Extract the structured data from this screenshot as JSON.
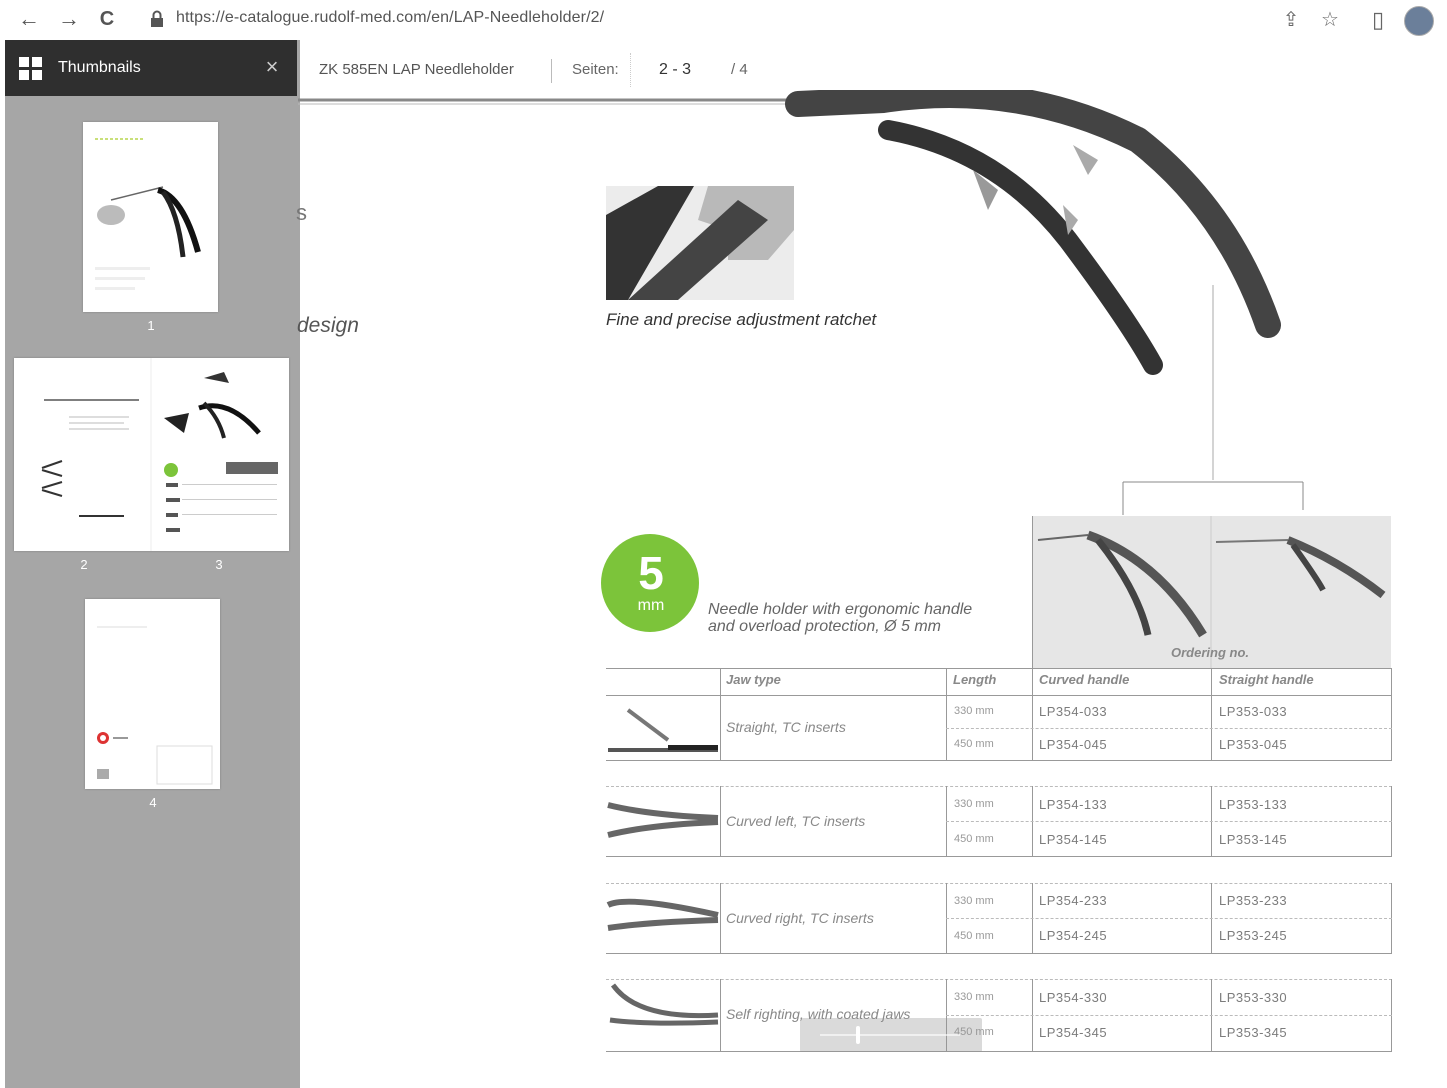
{
  "browser": {
    "url": "https://e-catalogue.rudolf-med.com/en/LAP-Needleholder/2/",
    "back_icon": "←",
    "forward_icon": "→",
    "reload_icon": "C",
    "share_icon": "⇪",
    "star_icon": "☆",
    "sidepanel_icon": "▯"
  },
  "sidebar": {
    "title": "Thumbnails",
    "close": "×",
    "pages": [
      {
        "label": "1"
      },
      {
        "label": "2"
      },
      {
        "label": "3"
      },
      {
        "label": "4"
      }
    ]
  },
  "viewer": {
    "doc_title": "ZK 585EN LAP Needleholder",
    "pages_label": "Seiten:",
    "page_value": "2 - 3",
    "page_total": "/ 4"
  },
  "content": {
    "partial_word_1": "s",
    "partial_word_2": "design",
    "ratchet_caption": "Fine and precise adjustment ratchet",
    "badge_number": "5",
    "badge_unit": "mm",
    "product_desc_1": "Needle holder with ergonomic handle",
    "product_desc_2": "and overload protection, Ø 5 mm",
    "ordering_label": "Ordering no.",
    "table": {
      "headers": [
        "Jaw type",
        "Length",
        "Curved handle",
        "Straight handle"
      ],
      "rows": [
        {
          "jaw": "Straight, TC inserts",
          "len1": "330 mm",
          "len2": "450 mm",
          "curved1": "LP354-033",
          "curved2": "LP354-045",
          "straight1": "LP353-033",
          "straight2": "LP353-045"
        },
        {
          "jaw": "Curved left, TC inserts",
          "len1": "330 mm",
          "len2": "450 mm",
          "curved1": "LP354-133",
          "curved2": "LP354-145",
          "straight1": "LP353-133",
          "straight2": "LP353-145"
        },
        {
          "jaw": "Curved right, TC inserts",
          "len1": "330 mm",
          "len2": "450 mm",
          "curved1": "LP354-233",
          "curved2": "LP354-245",
          "straight1": "LP353-233",
          "straight2": "LP353-245"
        },
        {
          "jaw": "Self righting, with coated jaws",
          "len1": "330 mm",
          "len2": "450 mm",
          "curved1": "LP354-330",
          "curved2": "LP354-345",
          "straight1": "LP353-330",
          "straight2": "LP353-345"
        }
      ]
    }
  },
  "colors": {
    "badge_green": "#7cc43a",
    "sidebar_bg": "#a6a6a6",
    "sidebar_header": "#2f2f2f"
  }
}
